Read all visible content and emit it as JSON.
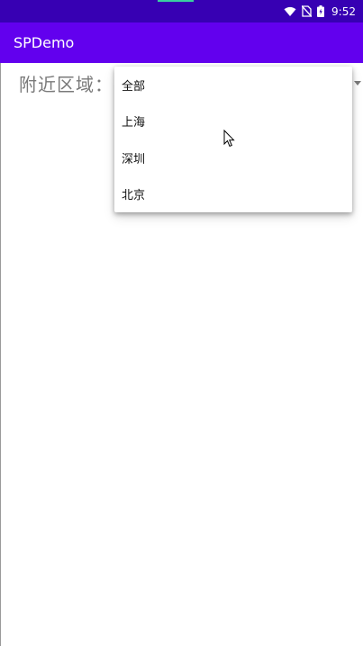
{
  "status_bar": {
    "time": "9:52",
    "icons": [
      "wifi-icon",
      "no-sim-icon",
      "battery-icon"
    ]
  },
  "app_bar": {
    "title": "SPDemo"
  },
  "main": {
    "label": "附近区域："
  },
  "dropdown": {
    "items": [
      {
        "label": "全部"
      },
      {
        "label": "上海"
      },
      {
        "label": "深圳"
      },
      {
        "label": "北京"
      }
    ]
  },
  "colors": {
    "status_bar": "#3700B3",
    "app_bar": "#6200EE"
  }
}
